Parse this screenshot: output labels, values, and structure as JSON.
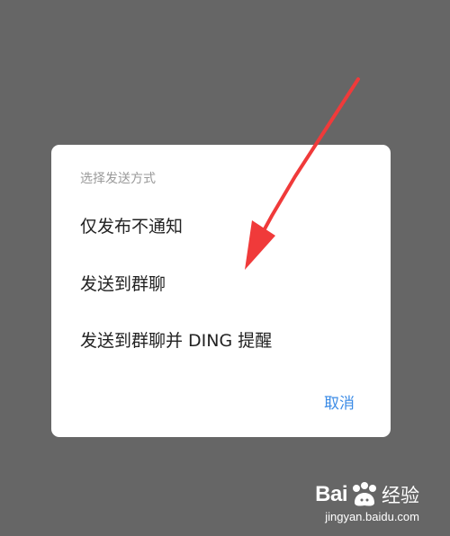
{
  "dialog": {
    "title": "选择发送方式",
    "options": [
      "仅发布不通知",
      "发送到群聊",
      "发送到群聊并 DING 提醒"
    ],
    "cancel_label": "取消"
  },
  "annotation": {
    "arrow_color": "#f03a3a"
  },
  "watermark": {
    "brand": "Bai",
    "brand_suffix": "经验",
    "url": "jingyan.baidu.com"
  },
  "colors": {
    "backdrop": "#666666",
    "dialog_bg": "#ffffff",
    "accent": "#3b8be6"
  }
}
